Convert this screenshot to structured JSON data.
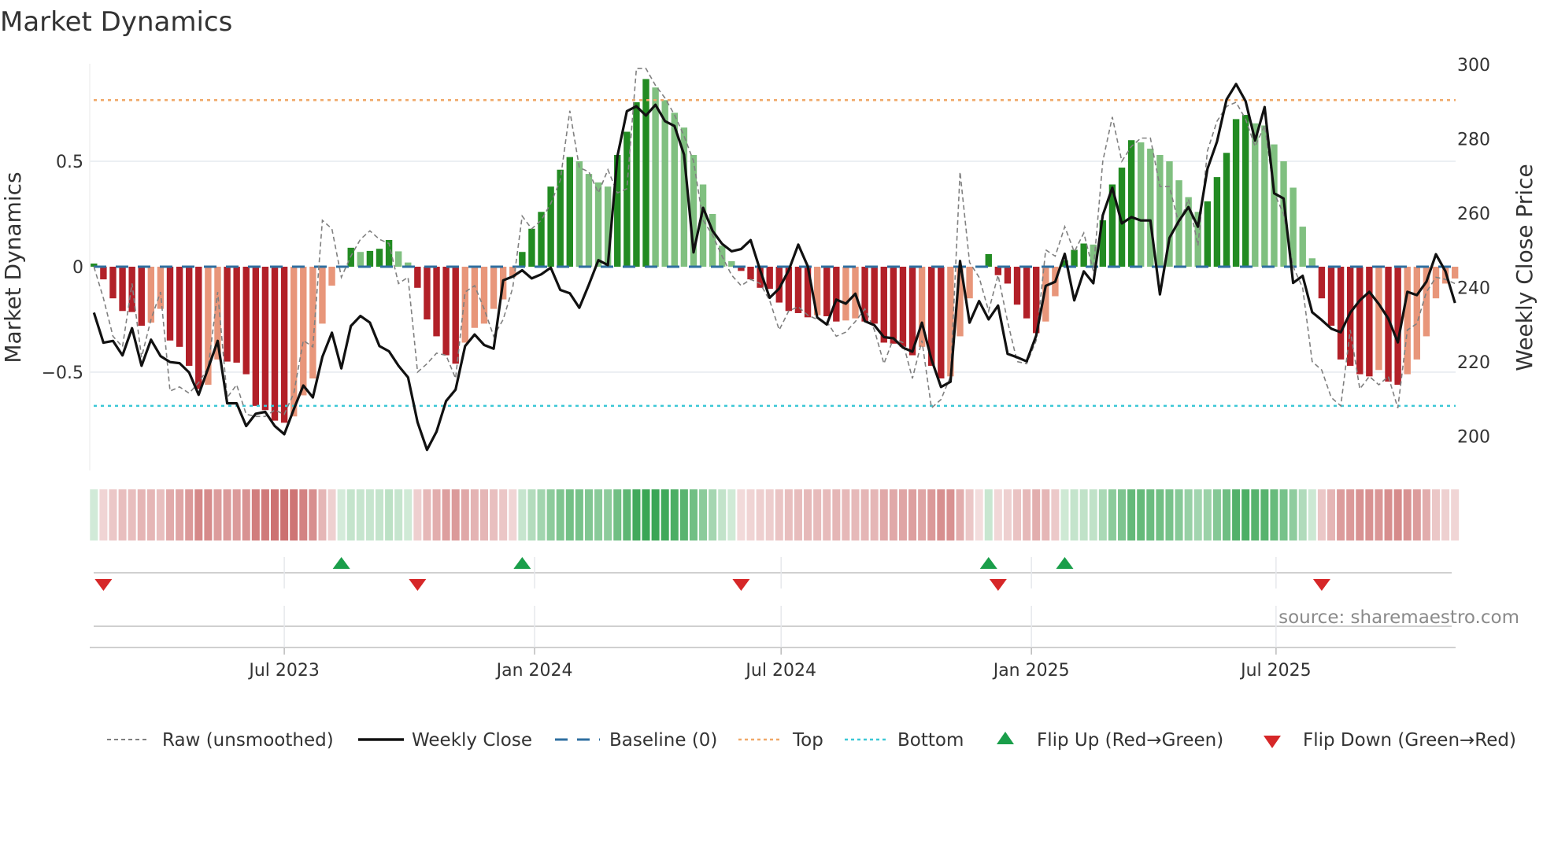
{
  "title": "Market Dynamics",
  "source": "source: sharemaestro.com",
  "colors": {
    "green_dark": "#228b22",
    "green_light": "#80c080",
    "red_dark": "#b22028",
    "red_light": "#e8967a",
    "raw": "#808080",
    "close": "#111111",
    "baseline": "#2f6fa0",
    "top": "#f0a868",
    "bottom": "#3cc8d6",
    "flip_up": "#1a9e4a",
    "flip_down": "#d62728",
    "grid": "#eceff3"
  },
  "chart_data": {
    "type": "bar",
    "title": "Market Dynamics",
    "ylabel": "Market Dynamics",
    "y2label": "Weekly Close Price",
    "ylim": [
      -0.98,
      0.95
    ],
    "y2lim": [
      195,
      301
    ],
    "yticks": [
      {
        "label": "0.5",
        "value": 0.5
      },
      {
        "label": "0",
        "value": 0
      },
      {
        "label": "−0.5",
        "value": -0.5
      }
    ],
    "y2ticks": [
      {
        "label": "300",
        "value": 300
      },
      {
        "label": "280",
        "value": 280
      },
      {
        "label": "260",
        "value": 260
      },
      {
        "label": "240",
        "value": 240
      },
      {
        "label": "220",
        "value": 220
      },
      {
        "label": "200",
        "value": 200
      }
    ],
    "xticks": [
      {
        "label": "Jul 2023",
        "index": 20.0
      },
      {
        "label": "Jan 2024",
        "index": 46.3
      },
      {
        "label": "Jul 2024",
        "index": 72.2
      },
      {
        "label": "Jan 2025",
        "index": 98.5
      },
      {
        "label": "Jul 2025",
        "index": 124.2
      }
    ],
    "top_level": 0.79,
    "bottom_level": -0.66,
    "baseline": 0,
    "dynamics": [
      0.015,
      -0.06,
      -0.15,
      -0.21,
      -0.215,
      -0.28,
      -0.265,
      -0.2,
      -0.35,
      -0.38,
      -0.47,
      -0.58,
      -0.56,
      -0.44,
      -0.45,
      -0.455,
      -0.51,
      -0.66,
      -0.68,
      -0.73,
      -0.74,
      -0.71,
      -0.61,
      -0.53,
      -0.27,
      -0.09,
      0.003,
      0.09,
      0.07,
      0.075,
      0.085,
      0.127,
      0.073,
      0.02,
      -0.1,
      -0.25,
      -0.33,
      -0.42,
      -0.46,
      -0.36,
      -0.29,
      -0.27,
      -0.2,
      -0.155,
      -0.05,
      0.07,
      0.18,
      0.26,
      0.38,
      0.46,
      0.52,
      0.5,
      0.44,
      0.4,
      0.38,
      0.53,
      0.64,
      0.78,
      0.89,
      0.85,
      0.79,
      0.73,
      0.66,
      0.53,
      0.39,
      0.25,
      0.1,
      0.026,
      -0.02,
      -0.06,
      -0.1,
      -0.105,
      -0.17,
      -0.21,
      -0.22,
      -0.24,
      -0.23,
      -0.235,
      -0.26,
      -0.255,
      -0.245,
      -0.26,
      -0.27,
      -0.36,
      -0.365,
      -0.38,
      -0.42,
      -0.38,
      -0.47,
      -0.53,
      -0.52,
      -0.33,
      -0.15,
      -0.005,
      0.06,
      -0.04,
      -0.08,
      -0.18,
      -0.245,
      -0.315,
      -0.26,
      -0.14,
      0.03,
      0.08,
      0.11,
      0.105,
      0.22,
      0.39,
      0.47,
      0.6,
      0.59,
      0.56,
      0.53,
      0.5,
      0.41,
      0.33,
      0.26,
      0.31,
      0.425,
      0.54,
      0.7,
      0.72,
      0.68,
      0.67,
      0.58,
      0.5,
      0.375,
      0.19,
      0.04,
      -0.15,
      -0.28,
      -0.44,
      -0.47,
      -0.51,
      -0.52,
      -0.49,
      -0.545,
      -0.56,
      -0.51,
      -0.44,
      -0.33,
      -0.15,
      -0.08,
      -0.056
    ],
    "raw": [
      0.0,
      -0.15,
      -0.33,
      -0.38,
      -0.08,
      -0.43,
      -0.25,
      -0.12,
      -0.59,
      -0.57,
      -0.6,
      -0.55,
      -0.48,
      -0.12,
      -0.62,
      -0.56,
      -0.7,
      -0.71,
      -0.71,
      -0.68,
      -0.7,
      -0.6,
      -0.35,
      -0.38,
      0.22,
      0.18,
      -0.05,
      0.05,
      0.13,
      0.17,
      0.13,
      0.11,
      -0.08,
      -0.05,
      -0.5,
      -0.46,
      -0.41,
      -0.42,
      -0.53,
      -0.12,
      -0.09,
      -0.2,
      -0.33,
      -0.25,
      -0.1,
      0.24,
      0.18,
      0.22,
      0.3,
      0.41,
      0.74,
      0.47,
      0.45,
      0.35,
      0.46,
      0.35,
      0.37,
      0.94,
      0.94,
      0.86,
      0.8,
      0.72,
      0.62,
      0.5,
      0.22,
      0.15,
      0.05,
      -0.04,
      -0.09,
      -0.06,
      -0.08,
      -0.16,
      -0.3,
      -0.21,
      -0.19,
      -0.23,
      -0.25,
      -0.26,
      -0.33,
      -0.31,
      -0.26,
      -0.2,
      -0.3,
      -0.46,
      -0.34,
      -0.36,
      -0.53,
      -0.35,
      -0.67,
      -0.63,
      -0.52,
      0.45,
      0.02,
      -0.05,
      -0.21,
      -0.04,
      -0.26,
      -0.45,
      -0.46,
      -0.35,
      0.08,
      0.05,
      0.19,
      0.07,
      0.16,
      -0.02,
      0.5,
      0.71,
      0.5,
      0.57,
      0.61,
      0.61,
      0.38,
      0.38,
      0.2,
      0.32,
      0.1,
      0.55,
      0.69,
      0.76,
      0.78,
      0.7,
      0.57,
      0.67,
      0.35,
      0.25,
      0.0,
      -0.1,
      -0.45,
      -0.49,
      -0.62,
      -0.66,
      -0.3,
      -0.58,
      -0.52,
      -0.56,
      -0.52,
      -0.67,
      -0.3,
      -0.27,
      -0.12,
      -0.05,
      -0.06,
      -0.08
    ],
    "close": [
      233.3,
      225.2,
      225.7,
      221.8,
      229.1,
      219.0,
      226.0,
      221.6,
      220.0,
      219.7,
      217.2,
      211.2,
      218.3,
      225.7,
      208.9,
      208.9,
      202.8,
      206.1,
      206.6,
      202.8,
      200.6,
      207.3,
      213.7,
      210.5,
      221.4,
      227.9,
      218.3,
      229.7,
      232.4,
      230.6,
      224.3,
      222.9,
      219.0,
      215.9,
      203.8,
      196.4,
      201.3,
      209.5,
      212.6,
      224.3,
      227.4,
      224.6,
      223.6,
      242.0,
      243.0,
      244.7,
      242.5,
      243.6,
      245.4,
      239.4,
      238.5,
      234.6,
      240.8,
      247.4,
      246.1,
      275.4,
      287.5,
      288.8,
      286.3,
      289.2,
      284.8,
      283.5,
      275.8,
      249.5,
      261.5,
      255.3,
      251.8,
      249.8,
      250.4,
      252.8,
      244.7,
      237.3,
      239.8,
      244.7,
      251.6,
      245.8,
      232.0,
      230.1,
      236.8,
      235.7,
      238.4,
      231.0,
      229.9,
      226.7,
      226.4,
      223.9,
      222.8,
      230.6,
      220.7,
      213.3,
      214.7,
      247.2,
      230.6,
      236.4,
      231.5,
      235.2,
      222.2,
      221.3,
      220.2,
      227.1,
      240.5,
      241.6,
      249.1,
      236.6,
      244.4,
      241.2,
      259.5,
      266.9,
      257.3,
      259.0,
      258.1,
      258.1,
      238.2,
      253.4,
      258.0,
      261.7,
      256.4,
      272.0,
      279.3,
      290.6,
      294.8,
      290.2,
      279.6,
      288.6,
      265.4,
      264.0,
      241.3,
      243.2,
      233.4,
      231.3,
      229.0,
      228.0,
      233.3,
      236.6,
      238.9,
      235.6,
      231.7,
      225.3,
      238.9,
      238.0,
      241.6,
      249.0,
      244.4,
      235.9
    ],
    "flip_up_indices": [
      26,
      45,
      94,
      102
    ],
    "flip_down_indices": [
      1,
      34,
      68,
      95,
      129
    ],
    "legend": {
      "placement": "bottom",
      "items": [
        {
          "label": "Raw (unsmoothed)",
          "kind": "raw"
        },
        {
          "label": "Weekly Close",
          "kind": "close"
        },
        {
          "label": "Baseline (0)",
          "kind": "baseline"
        },
        {
          "label": "Top",
          "kind": "top"
        },
        {
          "label": "Bottom",
          "kind": "bottom"
        },
        {
          "label": "Flip Up (Red→Green)",
          "kind": "flip_up"
        },
        {
          "label": "Flip Down (Green→Red)",
          "kind": "flip_down"
        }
      ]
    }
  }
}
